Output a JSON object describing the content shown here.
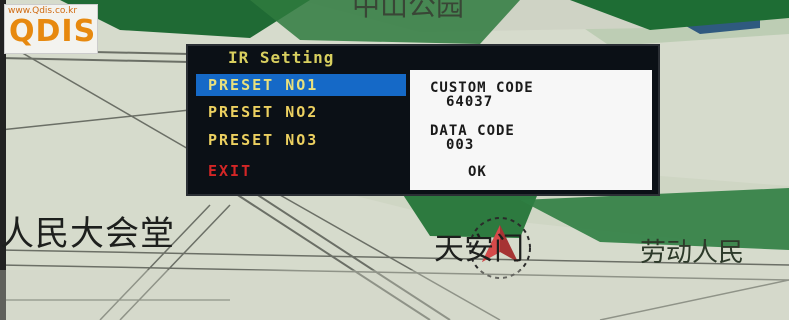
{
  "logo": {
    "url": "www.Qdis.co.kr",
    "name": "QDIS"
  },
  "map": {
    "labels": [
      "人民大会堂",
      "天安门",
      "劳动人民",
      "中山公园"
    ]
  },
  "osd": {
    "title": "IR Setting",
    "menu_items": [
      "PRESET NO1",
      "PRESET NO2",
      "PRESET NO3",
      "EXIT"
    ],
    "selected_index": 0,
    "info": {
      "custom_code_label": "CUSTOM CODE",
      "custom_code_value": "64037",
      "data_code_label": "DATA CODE",
      "data_code_value": "003",
      "ok_label": "OK"
    }
  },
  "colors": {
    "accent_selected": "#1569c7",
    "menu_text": "#ecd060",
    "exit_text": "#d42626",
    "panel_bg": "#f7f7f7"
  }
}
